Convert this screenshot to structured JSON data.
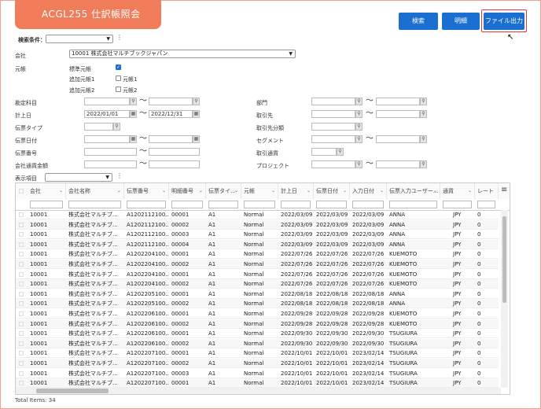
{
  "app_title": "ACGL255 仕訳帳照会",
  "toolbar": {
    "search": "検索",
    "detail": "明細",
    "file_output": "ファイル出力"
  },
  "search_condition": {
    "label": "検索条件：",
    "value": ""
  },
  "company": {
    "label": "会社",
    "value": "10001 株式会社マルチブックジャパン"
  },
  "ledger": {
    "label": "元帳",
    "standard": "標準元帳",
    "additional1": "追加元帳1",
    "additional2": "追加元帳2",
    "ledger1": "元帳1",
    "ledger2": "元帳2"
  },
  "filters": {
    "account": "勘定科目",
    "posting_date": "計上日",
    "posting_date_from": "2022/01/01",
    "posting_date_to": "2022/12/31",
    "voucher_type": "伝票タイプ",
    "voucher_date": "伝票日付",
    "voucher_no": "伝票番号",
    "company_currency_amount": "会社通貨金額",
    "department": "部門",
    "partner": "取引先",
    "partner_category": "取引先分類",
    "segment": "セグメント",
    "transaction_currency": "取引通貨",
    "project": "プロジェクト",
    "tilde": "〜"
  },
  "display_items": {
    "label": "表示項目",
    "value": ""
  },
  "columns": [
    "会社",
    "会社名称",
    "伝票番号",
    "明細番号",
    "伝票タイ...",
    "元帳",
    "計上日",
    "伝票日付",
    "入力日付",
    "伝票入力ユーザー...",
    "通貨",
    "レート"
  ],
  "rows": [
    [
      "10001",
      "株式会社マルチブ...",
      "A1202112100...",
      "00001",
      "A1",
      "Normal",
      "2022/03/09",
      "2022/03/09",
      "2022/03/09",
      "ANNA",
      "JPY",
      "0"
    ],
    [
      "10001",
      "株式会社マルチブ...",
      "A1202112100...",
      "00002",
      "A1",
      "Normal",
      "2022/03/09",
      "2022/03/09",
      "2022/03/09",
      "ANNA",
      "JPY",
      "0"
    ],
    [
      "10001",
      "株式会社マルチブ...",
      "A1202112100...",
      "00003",
      "A1",
      "Normal",
      "2022/03/09",
      "2022/03/09",
      "2022/03/09",
      "ANNA",
      "JPY",
      "0"
    ],
    [
      "10001",
      "株式会社マルチブ...",
      "A1202112100...",
      "00004",
      "A1",
      "Normal",
      "2022/03/09",
      "2022/03/09",
      "2022/03/09",
      "ANNA",
      "JPY",
      "0"
    ],
    [
      "10001",
      "株式会社マルチブ...",
      "A1202204100...",
      "00001",
      "A1",
      "Normal",
      "2022/07/26",
      "2022/07/26",
      "2022/07/26",
      "KUEMOTO",
      "JPY",
      "0"
    ],
    [
      "10001",
      "株式会社マルチブ...",
      "A1202204100...",
      "00002",
      "A1",
      "Normal",
      "2022/07/26",
      "2022/07/26",
      "2022/07/26",
      "KUEMOTO",
      "JPY",
      "0"
    ],
    [
      "10001",
      "株式会社マルチブ...",
      "A1202204100...",
      "00001",
      "A1",
      "Normal",
      "2022/07/26",
      "2022/07/26",
      "2022/07/26",
      "KUEMOTO",
      "JPY",
      "0"
    ],
    [
      "10001",
      "株式会社マルチブ...",
      "A1202204100...",
      "00002",
      "A1",
      "Normal",
      "2022/07/26",
      "2022/07/26",
      "2022/07/26",
      "KUEMOTO",
      "JPY",
      "0"
    ],
    [
      "10001",
      "株式会社マルチブ...",
      "A1202205100...",
      "00001",
      "A1",
      "Normal",
      "2022/08/18",
      "2022/08/18",
      "2022/08/18",
      "ANNA",
      "JPY",
      "0"
    ],
    [
      "10001",
      "株式会社マルチブ...",
      "A1202205100...",
      "00002",
      "A1",
      "Normal",
      "2022/08/18",
      "2022/08/18",
      "2022/08/18",
      "ANNA",
      "JPY",
      "0"
    ],
    [
      "10001",
      "株式会社マルチブ...",
      "A1202206100...",
      "00001",
      "A1",
      "Normal",
      "2022/09/28",
      "2022/09/28",
      "2022/09/28",
      "KUEMOTO",
      "JPY",
      "0"
    ],
    [
      "10001",
      "株式会社マルチブ...",
      "A1202206100...",
      "00002",
      "A1",
      "Normal",
      "2022/09/28",
      "2022/09/28",
      "2022/09/28",
      "KUEMOTO",
      "JPY",
      "0"
    ],
    [
      "10001",
      "株式会社マルチブ...",
      "A1202206100...",
      "00001",
      "A1",
      "Normal",
      "2022/09/30",
      "2022/09/30",
      "2022/09/30",
      "TSUGIURA",
      "JPY",
      "0"
    ],
    [
      "10001",
      "株式会社マルチブ...",
      "A1202206100...",
      "00002",
      "A1",
      "Normal",
      "2022/09/30",
      "2022/09/30",
      "2022/09/30",
      "TSUGIURA",
      "JPY",
      "0"
    ],
    [
      "10001",
      "株式会社マルチブ...",
      "A1202207100...",
      "00001",
      "A1",
      "Normal",
      "2022/10/01",
      "2022/10/01",
      "2023/02/14",
      "TSUGIURA",
      "JPY",
      "0"
    ],
    [
      "10001",
      "株式会社マルチブ...",
      "A1202207100...",
      "00002",
      "A1",
      "Normal",
      "2022/10/01",
      "2022/10/01",
      "2023/02/14",
      "TSUGIURA",
      "JPY",
      "0"
    ],
    [
      "10001",
      "株式会社マルチブ...",
      "A1202207100...",
      "00003",
      "A1",
      "Normal",
      "2022/10/01",
      "2022/10/01",
      "2023/02/14",
      "TSUGIURA",
      "JPY",
      "0"
    ],
    [
      "10001",
      "株式会社マルチブ...",
      "A1202207100...",
      "00001",
      "A1",
      "Normal",
      "2022/10/01",
      "2022/10/01",
      "2023/02/14",
      "TSUGIURA",
      "JPY",
      "0"
    ]
  ],
  "total_items": "Total Items: 34"
}
